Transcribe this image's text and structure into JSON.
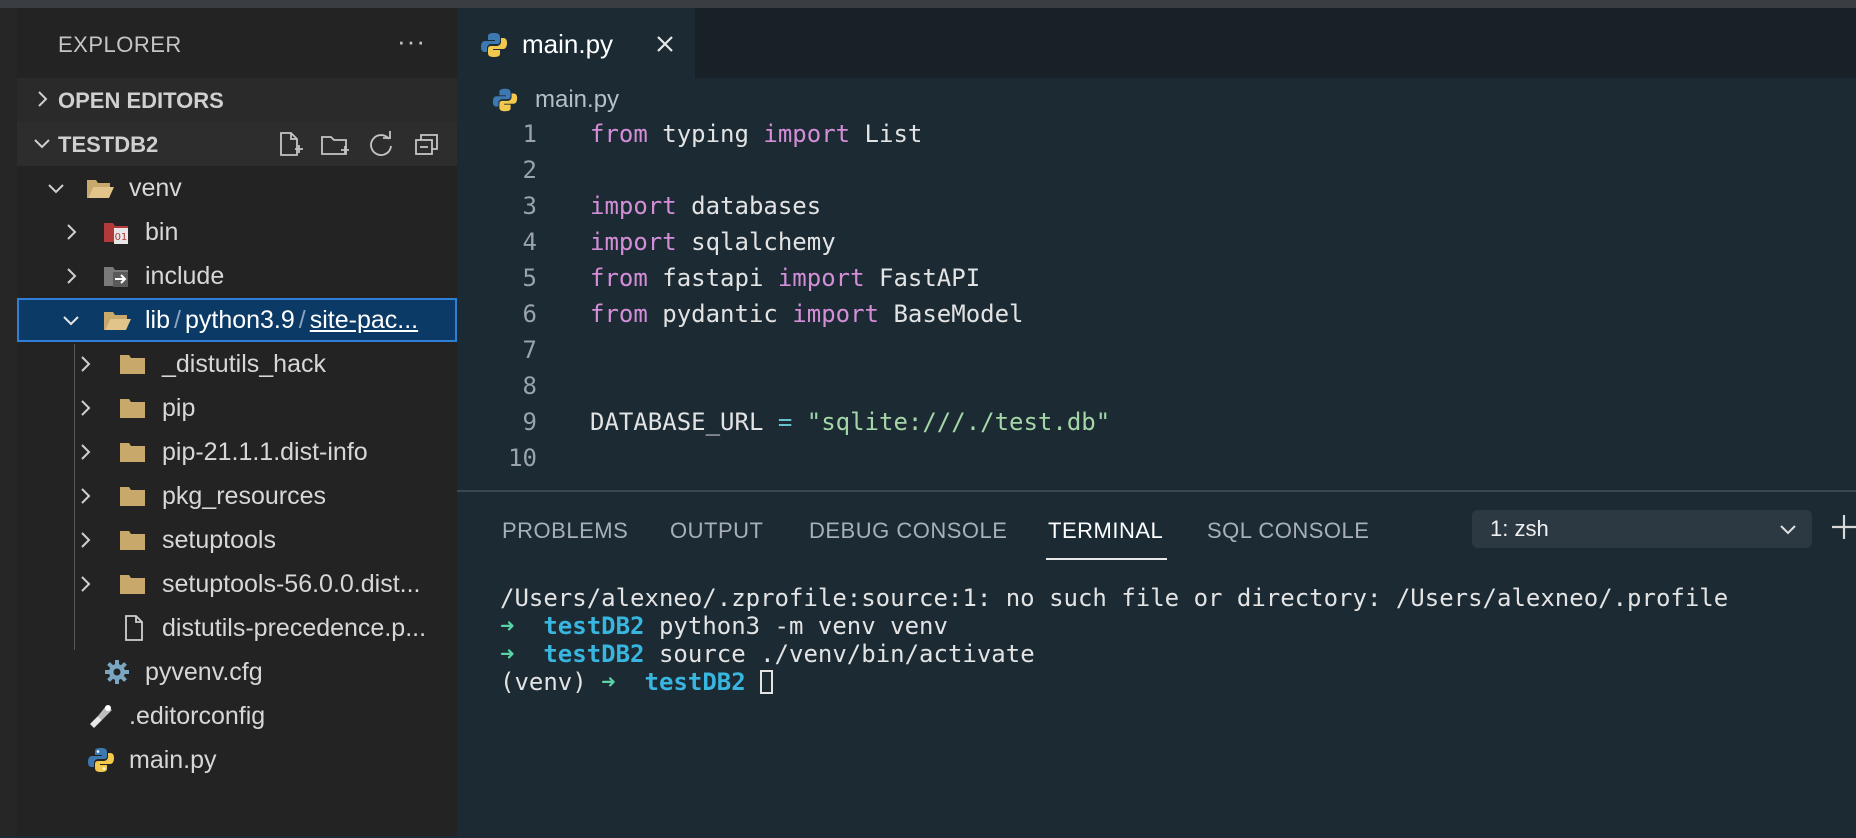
{
  "explorer": {
    "title": "EXPLORER",
    "more_label": "···",
    "open_editors_label": "OPEN EDITORS",
    "project_label": "TESTDB2",
    "tree": {
      "venv": "venv",
      "bin": "bin",
      "include": "include",
      "lib_path": {
        "part1": "lib",
        "sep": "/",
        "part2": "python3.9",
        "part3": "site-pac..."
      },
      "children": [
        "_distutils_hack",
        "pip",
        "pip-21.1.1.dist-info",
        "pkg_resources",
        "setuptools",
        "setuptools-56.0.0.dist..."
      ],
      "precedence_file": "distutils-precedence.p...",
      "pyvenv": "pyvenv.cfg",
      "editorconfig": ".editorconfig",
      "main": "main.py"
    }
  },
  "editor": {
    "tab_name": "main.py",
    "breadcrumb": "main.py",
    "line_numbers": [
      "1",
      "2",
      "3",
      "4",
      "5",
      "6",
      "7",
      "8",
      "9",
      "10"
    ],
    "code": {
      "l1": {
        "kw1": "from",
        "t1": " typing ",
        "kw2": "import",
        "t2": " List"
      },
      "l3": {
        "kw1": "import",
        "t1": " databases"
      },
      "l4": {
        "kw1": "import",
        "t1": " sqlalchemy"
      },
      "l5": {
        "kw1": "from",
        "t1": " fastapi ",
        "kw2": "import",
        "t2": " FastAPI"
      },
      "l6": {
        "kw1": "from",
        "t1": " pydantic ",
        "kw2": "import",
        "t2": " BaseModel"
      },
      "l9": {
        "name": "DATABASE_URL ",
        "op": "=",
        "str": " \"sqlite:///./test.db\""
      }
    }
  },
  "panel": {
    "tabs": [
      "PROBLEMS",
      "OUTPUT",
      "DEBUG CONSOLE",
      "TERMINAL",
      "SQL CONSOLE"
    ],
    "active_tab": "TERMINAL",
    "shell_select": "1: zsh",
    "terminal": {
      "line1": "/Users/alexneo/.zprofile:source:1: no such file or directory: /Users/alexneo/.profile",
      "prompt_arrow": "➜",
      "cwd": "testDB2",
      "cmd2": " python3 -m venv venv",
      "cmd3": " source ./venv/bin/activate",
      "venv_prefix": "(venv) "
    }
  },
  "colors": {
    "keyword": "#d48ed8",
    "string": "#a5d6a7",
    "terminal_arrow": "#5ad4a6",
    "terminal_cwd": "#38b6e0",
    "selection": "#0b3a66"
  }
}
